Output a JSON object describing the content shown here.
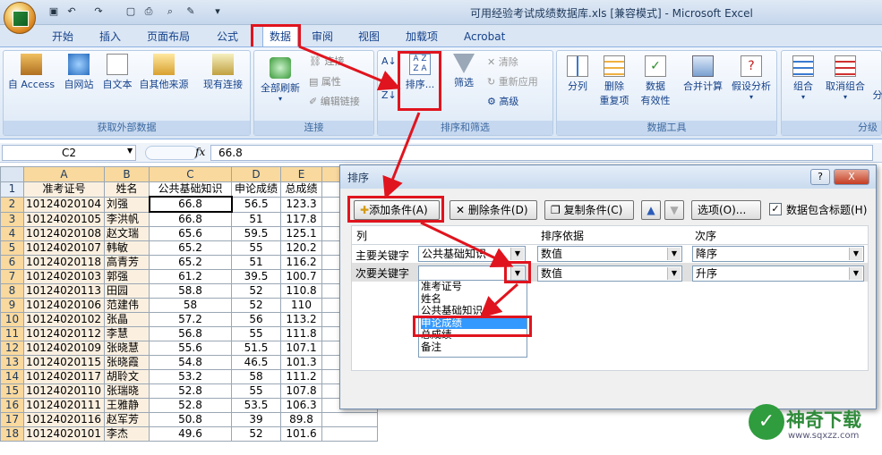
{
  "window": {
    "title": "可用经验考试成绩数据库.xls  [兼容模式] - Microsoft Excel"
  },
  "tabs": [
    "开始",
    "插入",
    "页面布局",
    "公式",
    "数据",
    "审阅",
    "视图",
    "加载项",
    "Acrobat"
  ],
  "ribbon": {
    "groups": {
      "external": {
        "label": "获取外部数据",
        "buttons": [
          "自 Access",
          "自网站",
          "自文本",
          "自其他来源",
          "现有连接"
        ]
      },
      "connections": {
        "label": "连接",
        "refresh": "全部刷新",
        "items": [
          "连接",
          "属性",
          "编辑链接"
        ]
      },
      "sort_filter": {
        "label": "排序和筛选",
        "sort": "排序...",
        "filter": "筛选",
        "items": [
          "清除",
          "重新应用",
          "高级"
        ]
      },
      "data_tools": {
        "label": "数据工具",
        "buttons": [
          "分列",
          "删除\n重复项",
          "数据\n有效性",
          "合并计算",
          "假设分析"
        ]
      },
      "outline": {
        "label": "分级",
        "buttons": [
          "组合",
          "取消组合",
          "分"
        ]
      }
    }
  },
  "formula_bar": {
    "name_box": "C2",
    "fx": "fx",
    "value": "66.8"
  },
  "sheet": {
    "columns": [
      "A",
      "B",
      "C",
      "D",
      "E"
    ],
    "rows": [
      [
        "1",
        "准考证号",
        "姓名",
        "公共基础知识",
        "申论成绩",
        "总成绩"
      ],
      [
        "2",
        "10124020104",
        "刘强",
        "66.8",
        "56.5",
        "123.3"
      ],
      [
        "3",
        "10124020105",
        "李洪帆",
        "66.8",
        "51",
        "117.8"
      ],
      [
        "4",
        "10124020108",
        "赵文瑞",
        "65.6",
        "59.5",
        "125.1"
      ],
      [
        "5",
        "10124020107",
        "韩敏",
        "65.2",
        "55",
        "120.2"
      ],
      [
        "6",
        "10124020118",
        "高青芳",
        "65.2",
        "51",
        "116.2"
      ],
      [
        "7",
        "10124020103",
        "郭强",
        "61.2",
        "39.5",
        "100.7"
      ],
      [
        "8",
        "10124020113",
        "田园",
        "58.8",
        "52",
        "110.8"
      ],
      [
        "9",
        "10124020106",
        "范建伟",
        "58",
        "52",
        "110"
      ],
      [
        "10",
        "10124020102",
        "张晶",
        "57.2",
        "56",
        "113.2"
      ],
      [
        "11",
        "10124020112",
        "李慧",
        "56.8",
        "55",
        "111.8"
      ],
      [
        "12",
        "10124020109",
        "张晓慧",
        "55.6",
        "51.5",
        "107.1"
      ],
      [
        "13",
        "10124020115",
        "张晓霞",
        "54.8",
        "46.5",
        "101.3"
      ],
      [
        "14",
        "10124020117",
        "胡聆文",
        "53.2",
        "58",
        "111.2"
      ],
      [
        "15",
        "10124020110",
        "张瑞晓",
        "52.8",
        "55",
        "107.8"
      ],
      [
        "16",
        "10124020111",
        "王雅静",
        "52.8",
        "53.5",
        "106.3"
      ],
      [
        "17",
        "10124020116",
        "赵军芳",
        "50.8",
        "39",
        "89.8"
      ],
      [
        "18",
        "10124020101",
        "李杰",
        "49.6",
        "52",
        "101.6"
      ]
    ]
  },
  "dialog": {
    "title": "排序",
    "help": "?",
    "close": "X",
    "buttons": {
      "add": "添加条件(A)",
      "delete": "删除条件(D)",
      "copy": "复制条件(C)",
      "options": "选项(O)...",
      "has_header": "数据包含标题(H)"
    },
    "headers": {
      "col": "列",
      "sort_on": "排序依据",
      "order": "次序"
    },
    "rows": [
      {
        "label": "主要关键字",
        "column": "公共基础知识",
        "sort_on": "数值",
        "order": "降序"
      },
      {
        "label": "次要关键字",
        "column": "",
        "sort_on": "数值",
        "order": "升序"
      }
    ],
    "dropdown": [
      "准考证号",
      "姓名",
      "公共基础知识",
      "申论成绩",
      "总成绩",
      "备注"
    ],
    "dropdown_selected": "申论成绩"
  },
  "watermark": {
    "brand": "神奇下载",
    "url": "www.sqxzz.com"
  }
}
